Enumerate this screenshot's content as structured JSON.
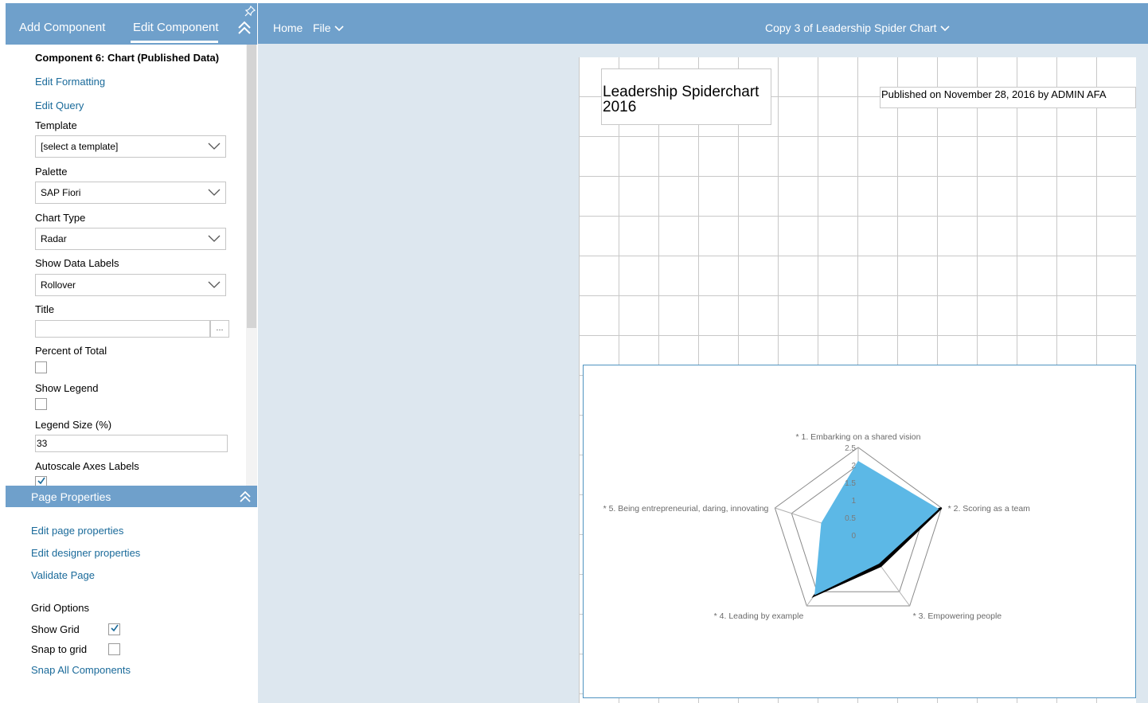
{
  "left_panel": {
    "tabs": {
      "add": "Add Component",
      "edit": "Edit Component"
    },
    "component_heading": "Component 6: Chart (Published Data)",
    "links": {
      "edit_formatting": "Edit Formatting",
      "edit_query": "Edit Query"
    },
    "template": {
      "label": "Template",
      "value": "[select a template]"
    },
    "palette": {
      "label": "Palette",
      "value": "SAP Fiori"
    },
    "chart_type": {
      "label": "Chart Type",
      "value": "Radar"
    },
    "show_data_labels": {
      "label": "Show Data Labels",
      "value": "Rollover"
    },
    "title_field": {
      "label": "Title",
      "value": "",
      "button": "..."
    },
    "percent_of_total": {
      "label": "Percent of Total",
      "checked": false
    },
    "show_legend": {
      "label": "Show Legend",
      "checked": false
    },
    "legend_size": {
      "label": "Legend Size (%)",
      "value": "33"
    },
    "autoscale_axes_labels": {
      "label": "Autoscale Axes Labels",
      "checked": true
    }
  },
  "page_properties": {
    "title": "Page Properties",
    "links": {
      "edit_page_properties": "Edit page properties",
      "edit_designer_properties": "Edit designer properties",
      "validate_page": "Validate Page",
      "snap_all_components": "Snap All Components"
    },
    "grid_options": {
      "label": "Grid Options",
      "show_grid": {
        "label": "Show Grid",
        "checked": true
      },
      "snap_to_grid": {
        "label": "Snap to grid",
        "checked": false
      }
    }
  },
  "toolbar": {
    "home": "Home",
    "file": "File",
    "document_title": "Copy 3 of Leadership Spider Chart"
  },
  "canvas": {
    "title": "Leadership Spiderchart 2016",
    "published": "Published on November 28, 2016 by ADMIN AFA"
  },
  "colors": {
    "header_blue": "#6fa0cb",
    "series_1": "#5cb8e6",
    "series_2": "#000000",
    "link": "#1a6a9a"
  },
  "chart_data": {
    "type": "radar",
    "categories": [
      "* 1. Embarking on a shared vision",
      "* 2. Scoring as a team",
      "* 3. Empowering people",
      "* 4. Leading by example",
      "* 5. Being entrepreneurial, daring, innovating"
    ],
    "radial_ticks": [
      "0",
      "0.5",
      "1",
      "1.5",
      "2",
      "2.5"
    ],
    "rmax": 2.5,
    "grid_rings": [
      1,
      2,
      2.5
    ],
    "series": [
      {
        "values": [
          2.1,
          2.4,
          1.0,
          2.1,
          1.1
        ]
      },
      {
        "values": [
          0,
          2.5,
          1.1,
          2.15,
          0
        ]
      }
    ]
  }
}
